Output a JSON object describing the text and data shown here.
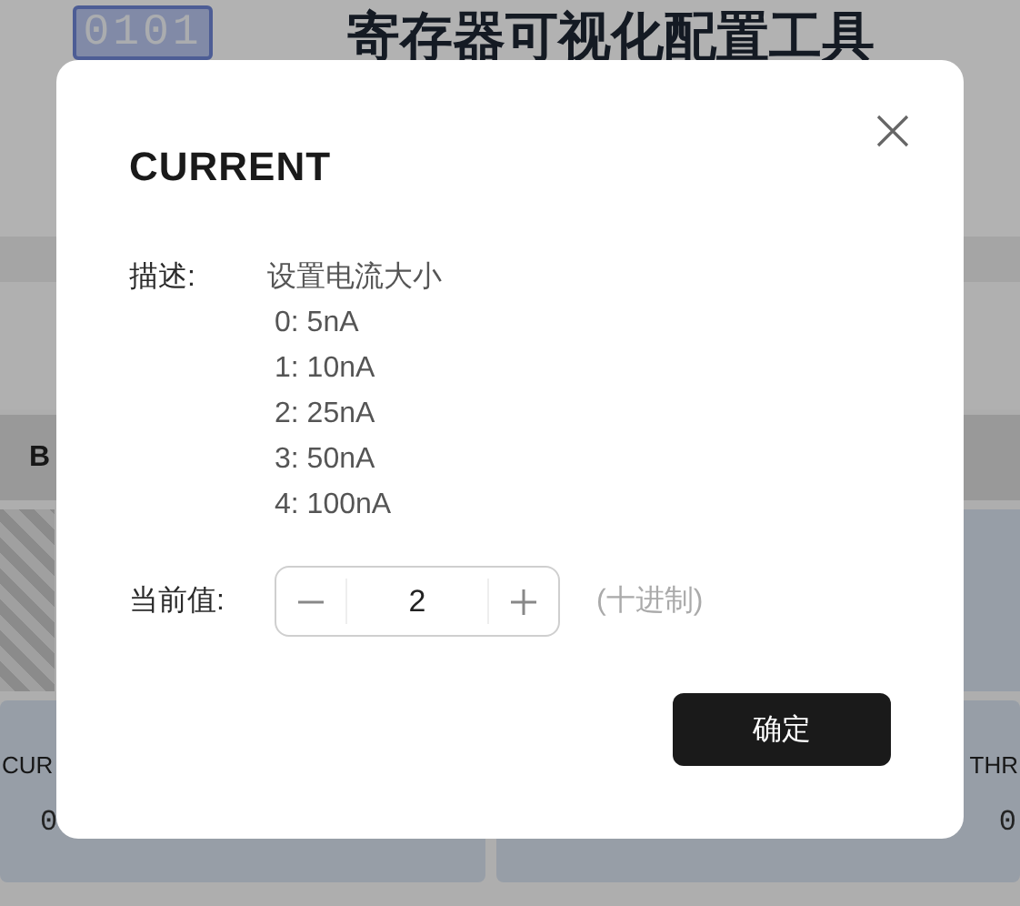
{
  "header": {
    "logo": "0101",
    "title": "寄存器可视化配置工具"
  },
  "background": {
    "section_label": "B",
    "cards": [
      {
        "name": "CUR",
        "value": "0"
      },
      {
        "name": "THR",
        "value": "0"
      }
    ]
  },
  "dialog": {
    "title": "CURRENT",
    "description_label": "描述:",
    "description_lines": [
      "设置电流大小",
      "0: 5nA",
      "1: 10nA",
      "2: 25nA",
      "3: 50nA",
      "4: 100nA"
    ],
    "value_label": "当前值:",
    "value": "2",
    "radix_note": "(十进制)",
    "confirm": "确定"
  }
}
